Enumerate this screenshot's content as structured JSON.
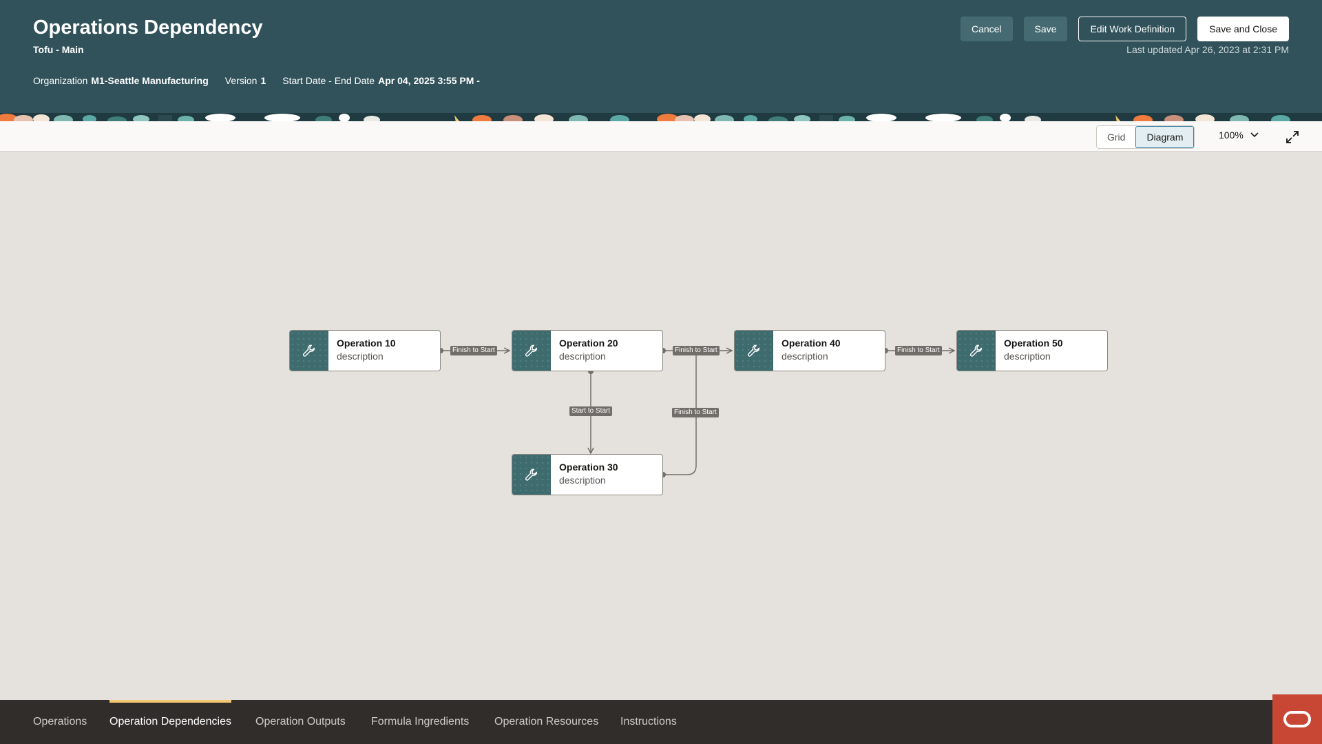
{
  "header": {
    "title": "Operations Dependency",
    "subtitle": "Tofu - Main",
    "organization_label": "Organization",
    "organization_value": "M1-Seattle Manufacturing",
    "version_label": "Version",
    "version_value": "1",
    "dates_label": "Start Date - End Date",
    "dates_value": "Apr 04, 2025 3:55 PM -",
    "cancel_label": "Cancel",
    "save_label": "Save",
    "edit_label": "Edit Work Definition",
    "save_close_label": "Save and Close",
    "last_updated": "Last updated Apr 26, 2023 at 2:31 PM"
  },
  "toolbar": {
    "grid_label": "Grid",
    "diagram_label": "Diagram",
    "zoom_label": "100%",
    "active_view": "Diagram"
  },
  "diagram": {
    "nodes": [
      {
        "title": "Operation 10",
        "desc": "description",
        "icon": "wrench-icon"
      },
      {
        "title": "Operation 20",
        "desc": "description",
        "icon": "wrench-icon"
      },
      {
        "title": "Operation 40",
        "desc": "description",
        "icon": "wrench-icon"
      },
      {
        "title": "Operation 50",
        "desc": "description",
        "icon": "wrench-icon"
      },
      {
        "title": "Operation 30",
        "desc": "description",
        "icon": "wrench-icon"
      }
    ],
    "edges": [
      {
        "from": "Operation 10",
        "to": "Operation 20",
        "label": "Finish to Start"
      },
      {
        "from": "Operation 20",
        "to": "Operation 40",
        "label": "Finish to Start"
      },
      {
        "from": "Operation 40",
        "to": "Operation 50",
        "label": "Finish to Start"
      },
      {
        "from": "Operation 20",
        "to": "Operation 30",
        "label": "Start to Start"
      },
      {
        "from": "Operation 30",
        "to": "Operation 40",
        "label": "Finish to Start"
      }
    ]
  },
  "tabs": [
    {
      "label": "Operations"
    },
    {
      "label": "Operation Dependencies"
    },
    {
      "label": "Operation Outputs"
    },
    {
      "label": "Formula Ingredients"
    },
    {
      "label": "Operation Resources"
    },
    {
      "label": "Instructions"
    }
  ],
  "active_tab": "Operation Dependencies",
  "colors": {
    "header_bg": "#31525a",
    "node_icon_bg": "#3e6b6e",
    "tab_bar_bg": "#312d2a",
    "active_tab_accent": "#f2c970",
    "oracle_red": "#c74634"
  }
}
